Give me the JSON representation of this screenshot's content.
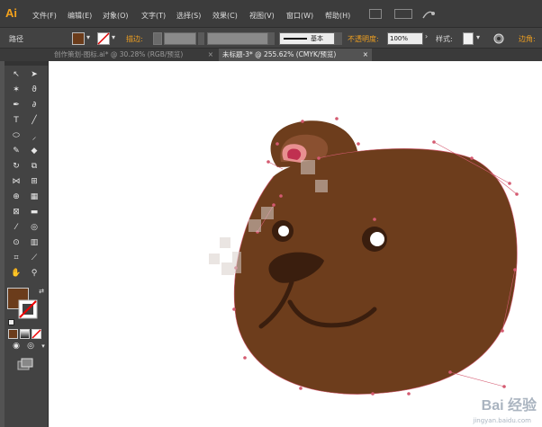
{
  "app": {
    "logo": "Ai"
  },
  "menus": [
    "文件(F)",
    "编辑(E)",
    "对象(O)",
    "文字(T)",
    "选择(S)",
    "效果(C)",
    "视图(V)",
    "窗口(W)",
    "帮助(H)"
  ],
  "options": {
    "selection_label": "路径",
    "stroke_label": "描边:",
    "stroke_style": "基本",
    "opacity_label": "不透明度:",
    "opacity_value": "100%",
    "style_label": "样式:",
    "extra_label": "边角:"
  },
  "tabs": [
    {
      "label": "创作策划-图标.ai* @ 30.28% (RGB/预览)",
      "close": "×"
    },
    {
      "label": "未标题-3* @ 255.62% (CMYK/预览)",
      "close": "×"
    }
  ],
  "colors": {
    "fill": "#6b3c1b",
    "bear_face": "#6d3d1c",
    "ear_inner": "#8a5030",
    "ear_pink": "#e89090",
    "nose": "#3a1e0e",
    "path_points": "#d45a70"
  },
  "watermark": {
    "brand": "Bai 经验",
    "url": "jingyan.baidu.com"
  }
}
